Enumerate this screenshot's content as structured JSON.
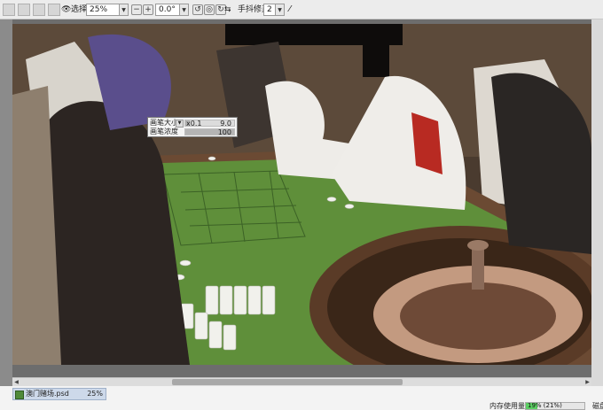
{
  "toolbar": {
    "select_label": "选择",
    "zoom_value": "25%",
    "rotate_value": "0.0°",
    "stabilizer_label": "手抖修正",
    "stabilizer_value": "2"
  },
  "brush_popup": {
    "size_label": "画笔大小",
    "size_multiplier": "x0.1",
    "size_value": "9.0",
    "size_level": 0.09,
    "density_label": "画笔浓度",
    "density_value": "100",
    "density_level": 1.0
  },
  "document_tab": {
    "file_name": "澳门赌场.psd",
    "zoom": "25%"
  },
  "status": {
    "memory_label": "内存使用量",
    "memory_text": "19% (21%)",
    "memory_level": 0.19,
    "trailing_label": "磁盘"
  },
  "colors": {
    "table_felt": "#5f8f3a",
    "table_wood": "#6b4a33",
    "memory_fill": "#5ccf63",
    "file_tab": "#cdd9ea"
  }
}
